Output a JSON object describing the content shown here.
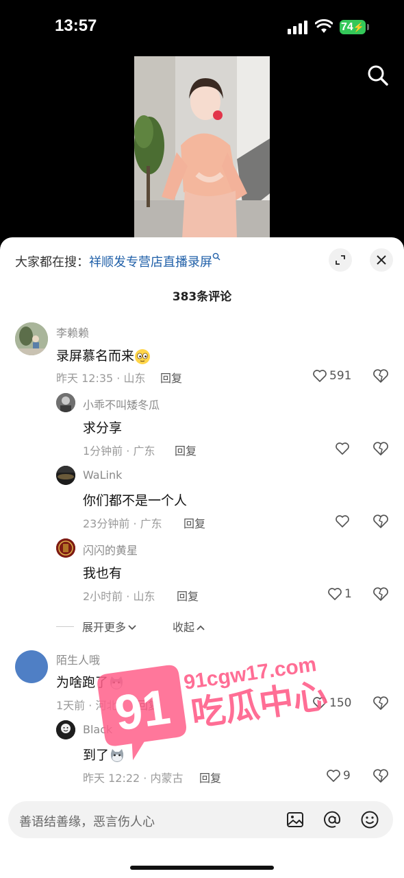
{
  "status_bar": {
    "time": "13:57",
    "battery": "74"
  },
  "trending": {
    "prefix": "大家都在搜：",
    "keyword": "祥顺发专营店直播录屏"
  },
  "comments_count": "383条评论",
  "comments": [
    {
      "name": "李赖赖",
      "text": "录屏慕名而来",
      "meta": "昨天 12:35 · 山东",
      "reply": "回复",
      "likes": "591"
    },
    {
      "name": "小乖不叫矮冬瓜",
      "text": "求分享",
      "meta": "1分钟前 · 广东",
      "reply": "回复",
      "likes": ""
    },
    {
      "name": "WaLink",
      "text": "你们都不是一个人",
      "meta": "23分钟前 · 广东",
      "reply": "回复",
      "likes": ""
    },
    {
      "name": "闪闪的黄星",
      "text": "我也有",
      "meta": "2小时前 · 山东",
      "reply": "回复",
      "likes": "1"
    },
    {
      "name": "陌生人哦",
      "text": "为啥跑了",
      "meta": "1天前 · 河北",
      "reply": "回复",
      "likes": "150"
    },
    {
      "name": "Black",
      "text": "到了",
      "meta": "昨天 12:22 · 内蒙古",
      "reply": "回复",
      "likes": "9"
    }
  ],
  "thread_controls": {
    "expand_more": "展开更多",
    "collapse": "收起"
  },
  "watermark": {
    "number": "91",
    "domain": "91cgw17.com",
    "title": "吃瓜中心"
  },
  "input": {
    "placeholder": "善语结善缘，恶言伤人心"
  },
  "icons": [
    "search-icon",
    "expand-icon",
    "close-icon",
    "heart-icon",
    "broken-heart-icon",
    "image-icon",
    "at-icon",
    "emoji-icon"
  ]
}
